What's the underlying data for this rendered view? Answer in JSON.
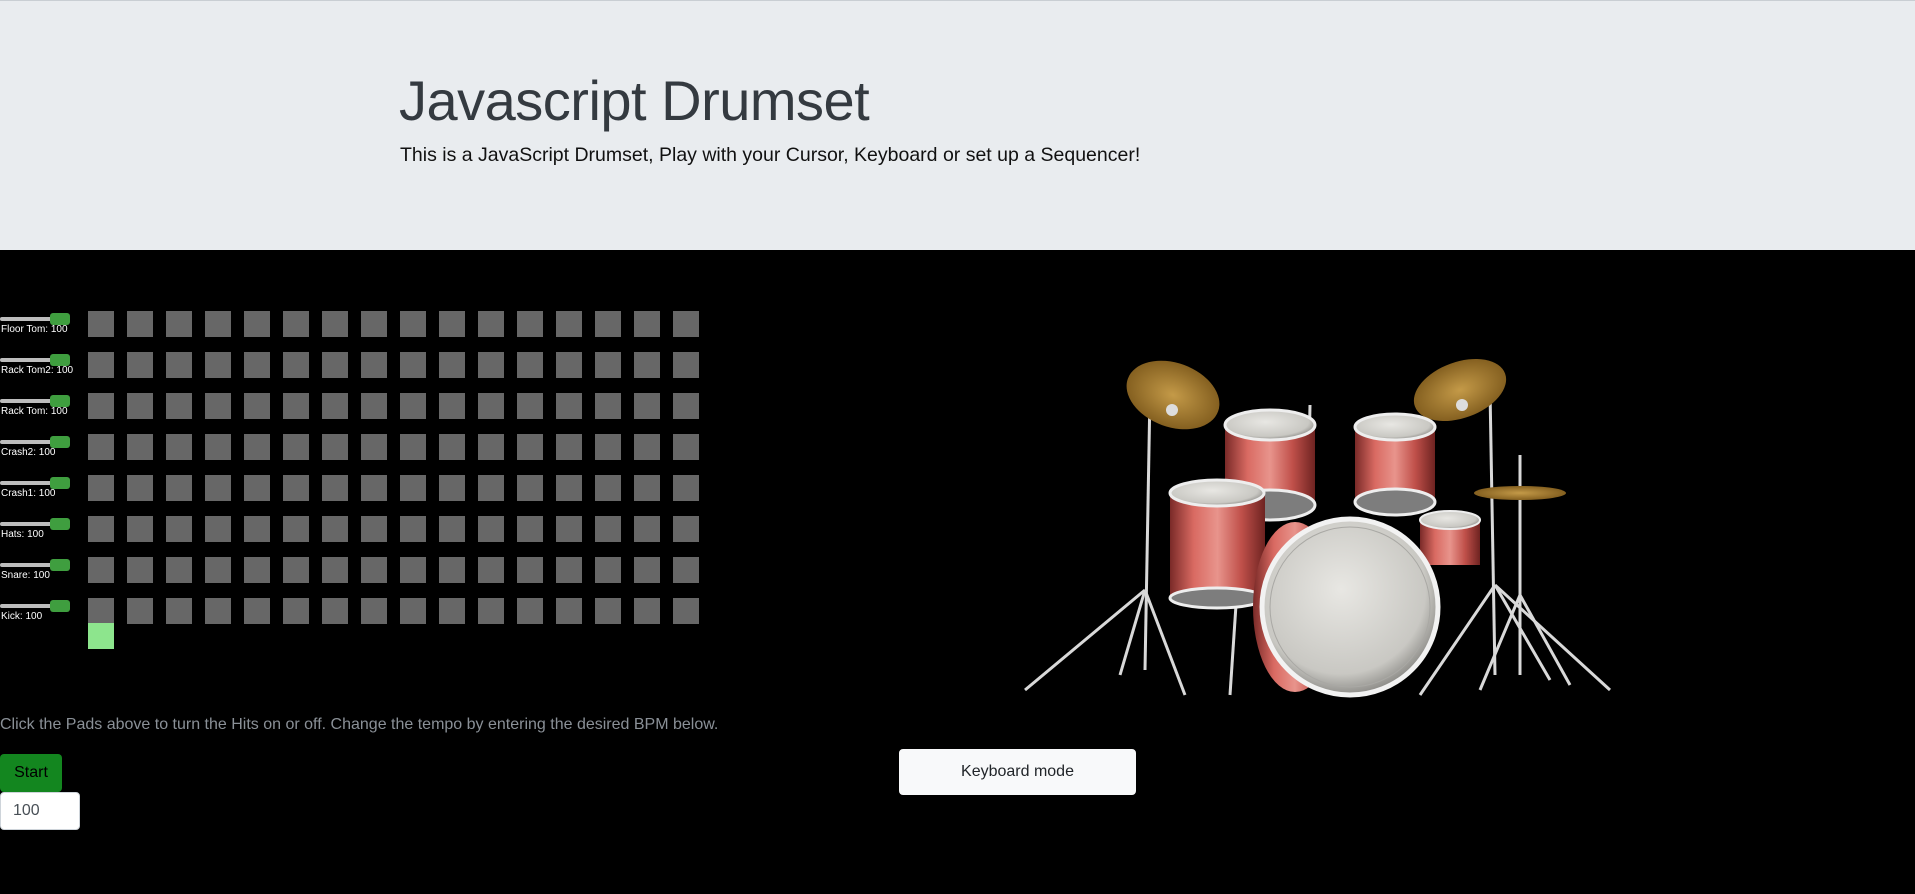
{
  "header": {
    "title": "Javascript Drumset",
    "lead": "This is a JavaScript Drumset, Play with your Cursor, Keyboard or set up a Sequencer!"
  },
  "sequencer": {
    "steps": 16,
    "tracks": [
      {
        "name": "Floor Tom",
        "volume": 100,
        "label": "Floor Tom: 100"
      },
      {
        "name": "Rack Tom2",
        "volume": 100,
        "label": "Rack Tom2: 100"
      },
      {
        "name": "Rack Tom",
        "volume": 100,
        "label": "Rack Tom: 100"
      },
      {
        "name": "Crash2",
        "volume": 100,
        "label": "Crash2: 100"
      },
      {
        "name": "Crash1",
        "volume": 100,
        "label": "Crash1: 100"
      },
      {
        "name": "Hats",
        "volume": 100,
        "label": "Hats: 100"
      },
      {
        "name": "Snare",
        "volume": 100,
        "label": "Snare: 100"
      },
      {
        "name": "Kick",
        "volume": 100,
        "label": "Kick: 100"
      }
    ],
    "current_step": 1,
    "instructions": "Click the Pads above to turn the Hits on or off. Change the tempo by entering the desired BPM below.",
    "start_label": "Start",
    "bpm_value": "100"
  },
  "keyboard_button": "Keyboard mode",
  "colors": {
    "pad_off": "#676767",
    "step_indicator": "#8de58d",
    "start_button": "#13861f",
    "jumbotron": "#e9ecef"
  }
}
